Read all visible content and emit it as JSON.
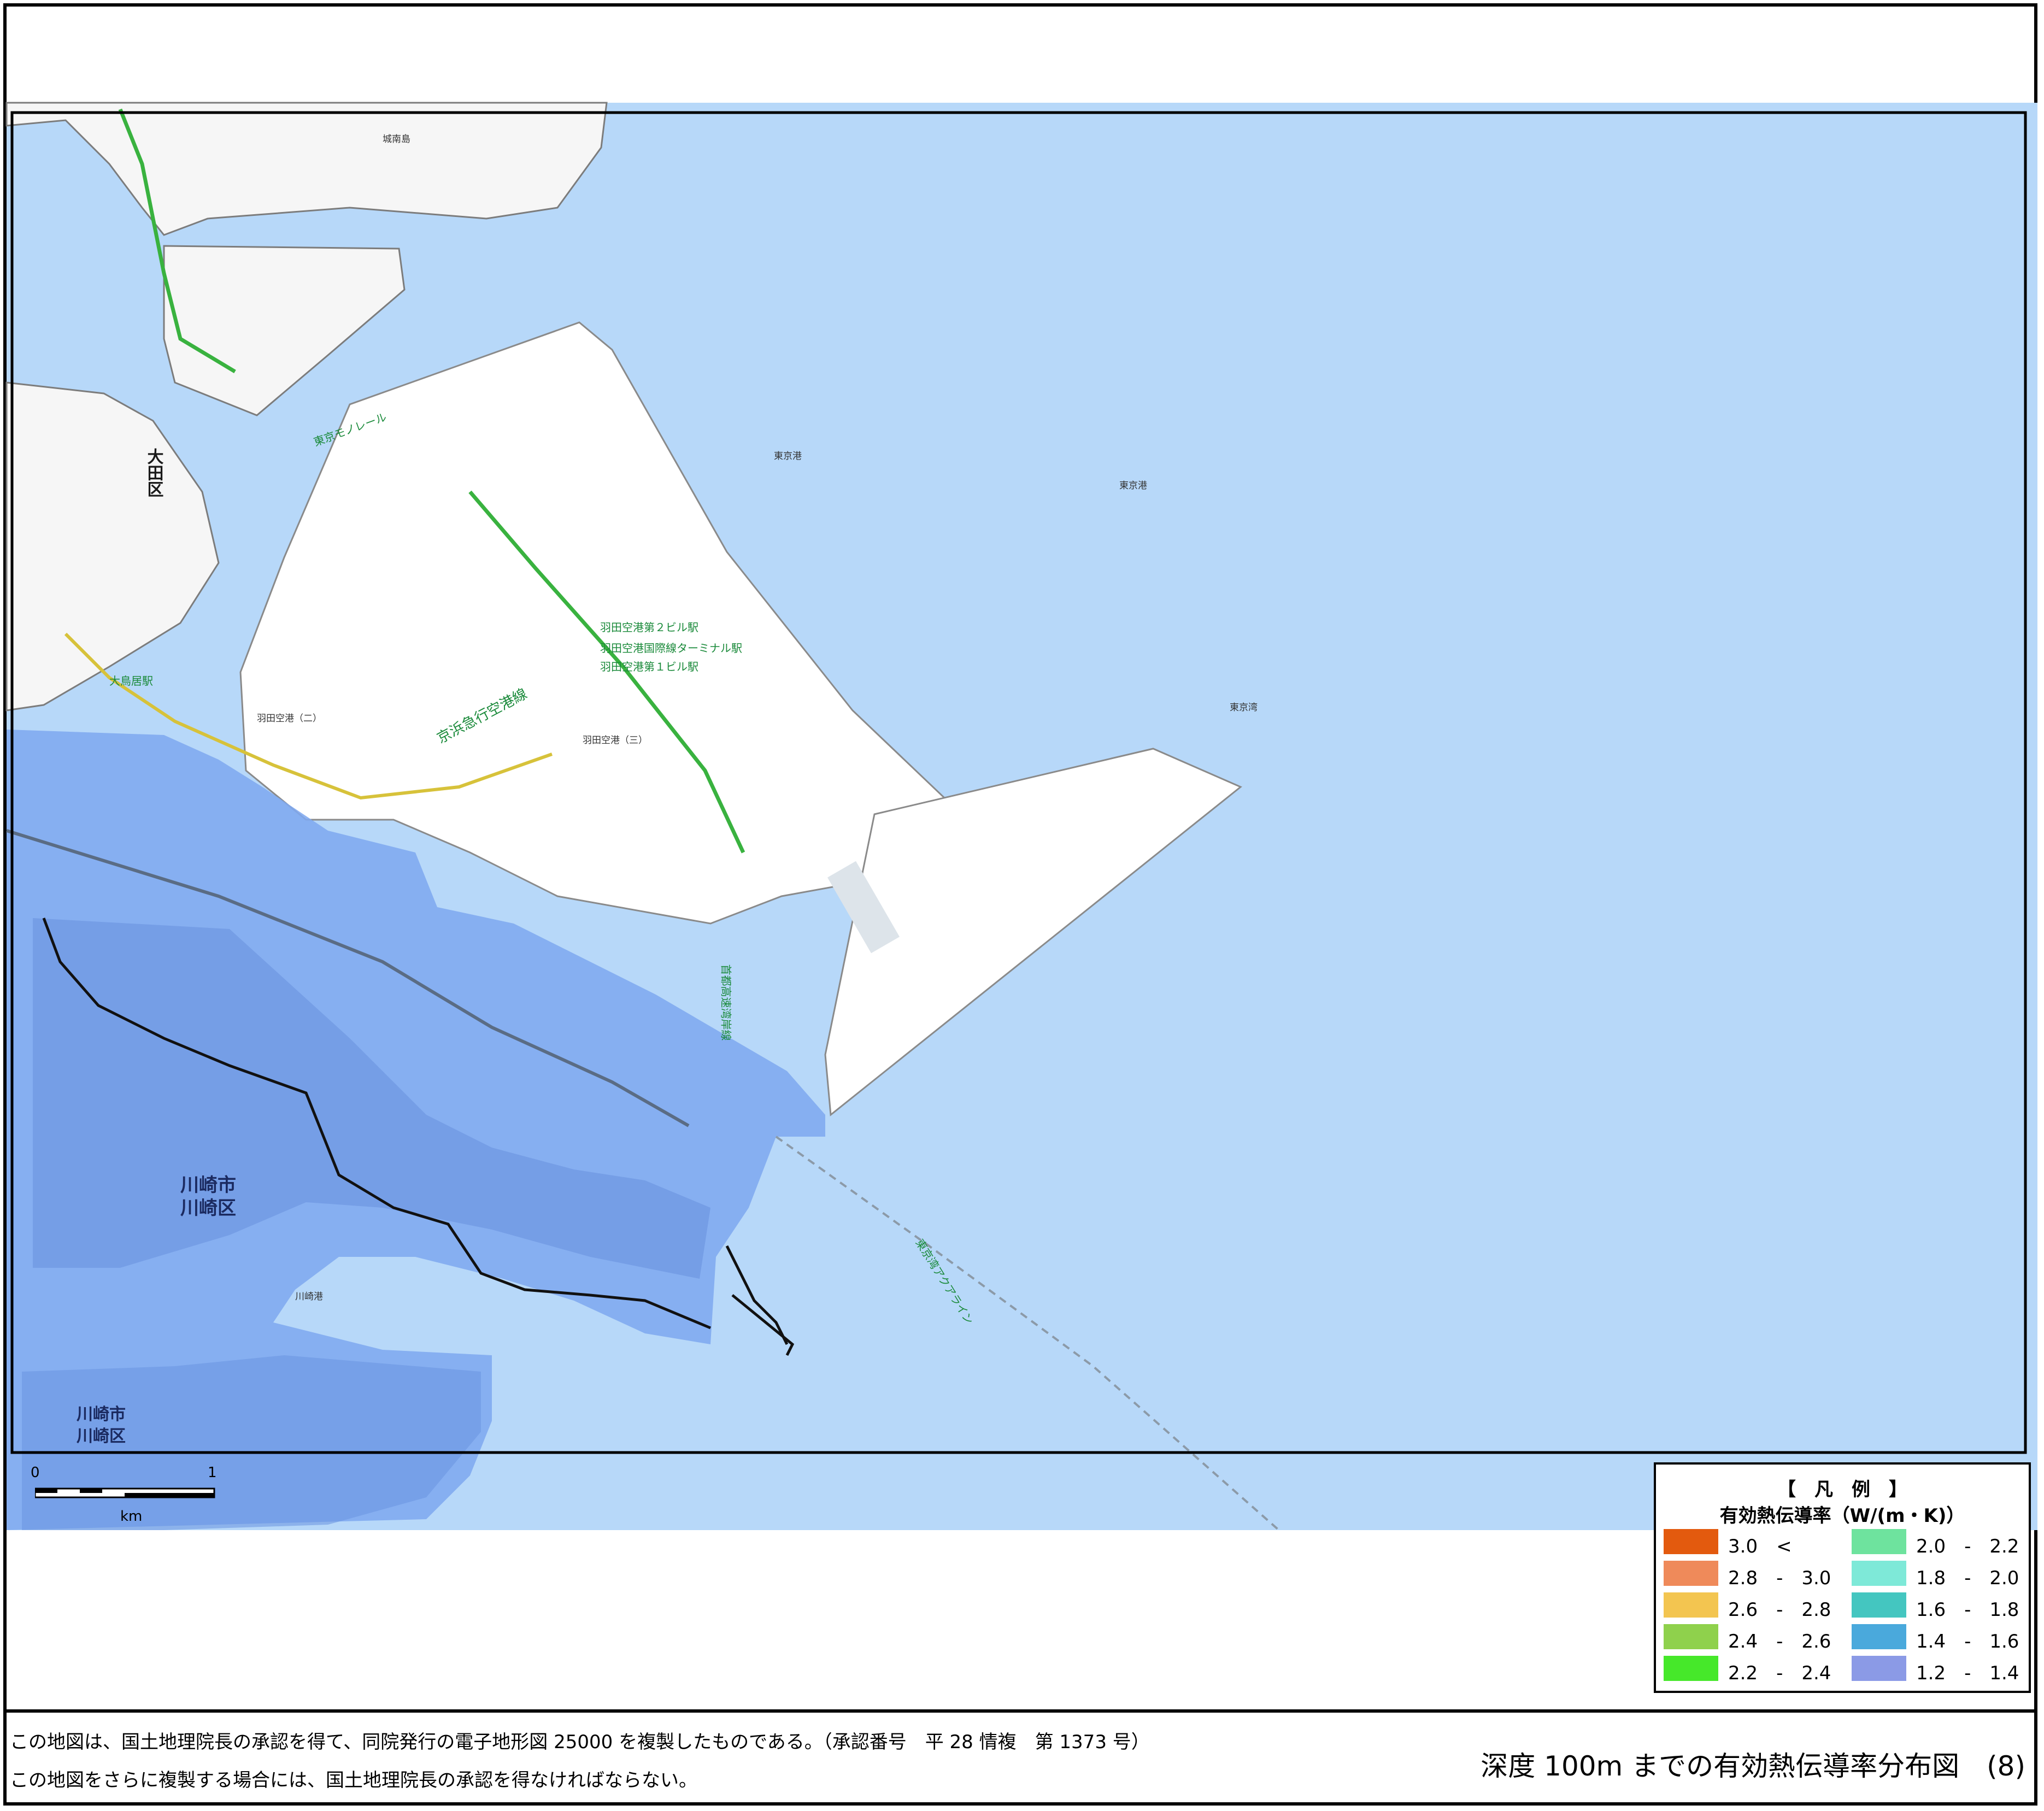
{
  "map": {
    "place_labels": {
      "ota_ward": "大田区",
      "kawasaki_city_upper": "川崎市",
      "kawasaki_ward_upper": "川崎区",
      "kawasaki_city_lower": "川崎市",
      "kawasaki_ward_lower": "川崎区",
      "tokyo_bay": "東京湾",
      "tokyo_port_1": "東京港",
      "tokyo_port_2": "東京港"
    },
    "feature_labels": {
      "keikyu_airport_line": "京浜急行空港線",
      "haneda_terminal2": "羽田空港第２ビル駅",
      "haneda_intl_terminal": "羽田空港国際線ターミナル駅",
      "haneda_terminal1": "羽田空港第１ビル駅",
      "haneda_airport_2": "羽田空港（二）",
      "haneda_airport_3": "羽田空港（三）",
      "aqualine": "東京湾アクアライン",
      "shuto_expressway": "首都高速湾岸線",
      "jonanjima": "城南島",
      "kawasaki_port": "川崎港",
      "tokyo_monorail": "東京モノレール",
      "ota_hospital": "大鳥居駅"
    },
    "scale": {
      "zero": "0",
      "one": "1",
      "unit": "km"
    }
  },
  "legend": {
    "title": "【　凡　例　】",
    "subtitle": "有効熱伝導率（W/(m・K)）",
    "classes": [
      {
        "label": "3.0　<",
        "color": "#e35a0e"
      },
      {
        "label": "2.8　-　3.0",
        "color": "#ef8a5a"
      },
      {
        "label": "2.6　-　2.8",
        "color": "#f3c550"
      },
      {
        "label": "2.4　-　2.6",
        "color": "#8fd14c"
      },
      {
        "label": "2.2　-　2.4",
        "color": "#46e82a"
      },
      {
        "label": "2.0　-　2.2",
        "color": "#6ee39e"
      },
      {
        "label": "1.8　-　2.0",
        "color": "#7ee9d8"
      },
      {
        "label": "1.6　-　1.8",
        "color": "#44c6c0"
      },
      {
        "label": "1.4　-　1.6",
        "color": "#4aa9dc"
      },
      {
        "label": "1.2　-　1.4",
        "color": "#8b9ae6"
      }
    ]
  },
  "footer": {
    "notice_1": "この地図は、国土地理院長の承認を得て、同院発行の電子地形図 25000 を複製したものである。（承認番号　平 28 情複　第 1373 号）",
    "notice_2": "この地図をさらに複製する場合には、国土地理院長の承認を得なければならない。",
    "sheet_title": "深度 100m までの有効熱伝導率分布図　(8)"
  }
}
